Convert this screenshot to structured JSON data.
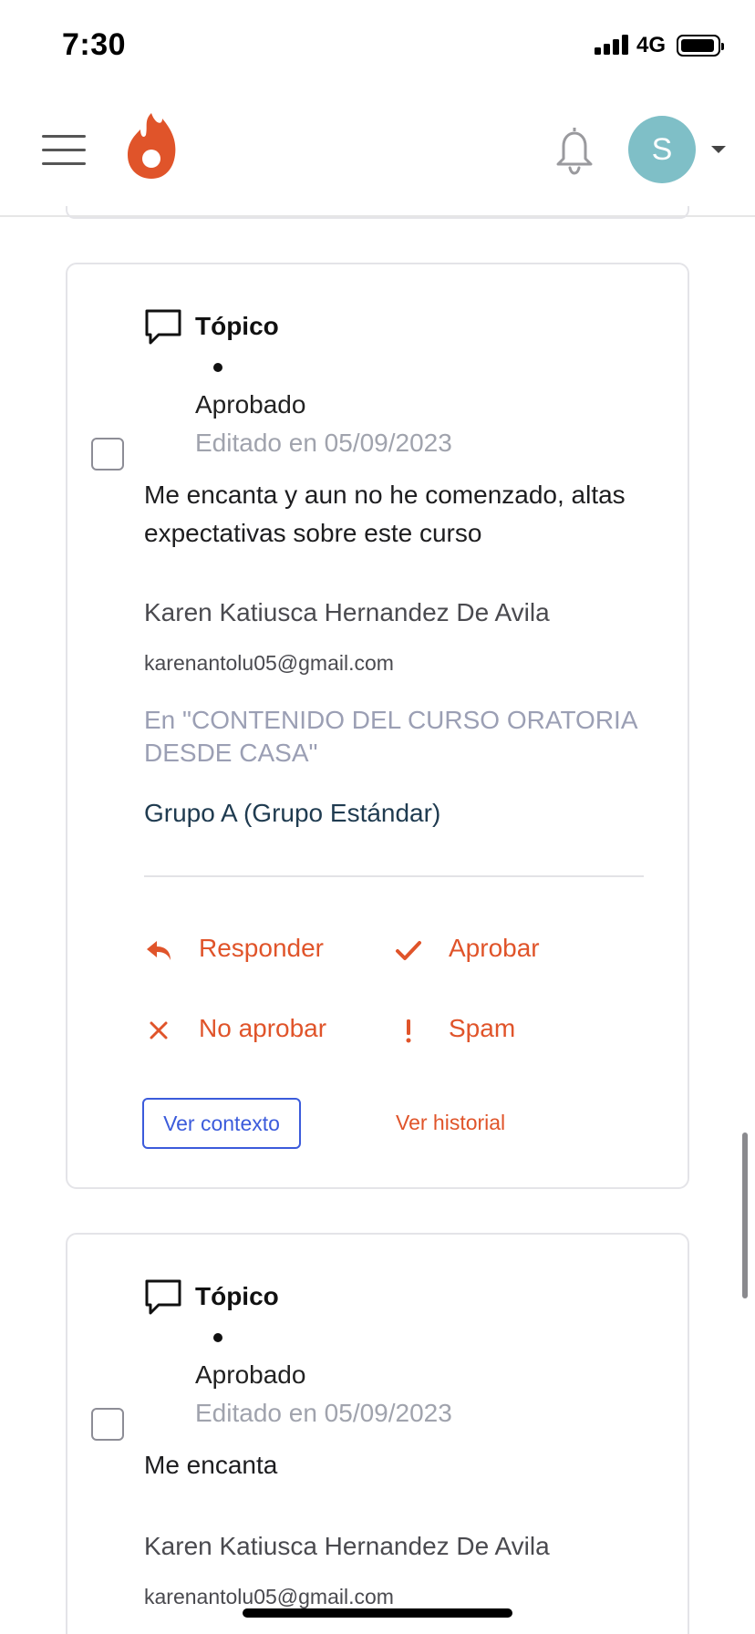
{
  "status_bar": {
    "time": "7:30",
    "network": "4G"
  },
  "header": {
    "avatar_initial": "S"
  },
  "cards": [
    {
      "type": "Tópico",
      "status": "Aprobado",
      "edited": "Editado en 05/09/2023",
      "body": "Me encanta y aun no he comenzado, altas expectativas sobre este curso",
      "author_name": "Karen Katiusca Hernandez De Avila",
      "author_email": "karenantolu05@gmail.com",
      "course": "En \"CONTENIDO DEL CURSO ORATORIA DESDE CASA\"",
      "group": "Grupo A (Grupo Estándar)",
      "actions": {
        "reply": "Responder",
        "approve": "Aprobar",
        "reject": "No aprobar",
        "spam": "Spam"
      },
      "context_button": "Ver contexto",
      "history_link": "Ver historial"
    },
    {
      "type": "Tópico",
      "status": "Aprobado",
      "edited": "Editado en 05/09/2023",
      "body": "Me encanta",
      "author_name": "Karen Katiusca Hernandez De Avila",
      "author_email": "karenantolu05@gmail.com"
    }
  ],
  "colors": {
    "accent": "#e0542a",
    "link_blue": "#3b5bdb",
    "avatar_bg": "#7fbfc7",
    "muted": "#a0a3ad"
  },
  "icons": [
    "menu-icon",
    "flame-logo-icon",
    "bell-icon",
    "caret-down-icon",
    "chat-bubble-icon",
    "reply-icon",
    "check-icon",
    "close-icon",
    "exclamation-icon"
  ]
}
